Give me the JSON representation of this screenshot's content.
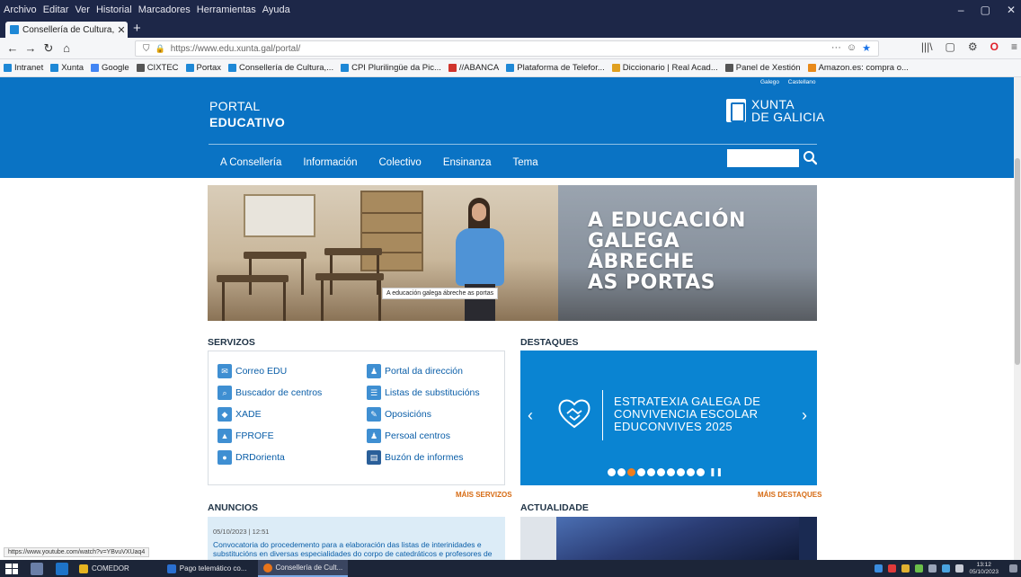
{
  "browser": {
    "menu": [
      "Archivo",
      "Editar",
      "Ver",
      "Historial",
      "Marcadores",
      "Herramientas",
      "Ayuda"
    ],
    "window_controls": [
      "–",
      "▢",
      "✕"
    ],
    "tab_title": "Consellería de Cultura, Educac...",
    "tab_close": "✕",
    "new_tab": "+",
    "nav": {
      "back": "←",
      "forward": "→",
      "reload": "↻",
      "home": "⌂"
    },
    "url": "https://www.edu.xunta.gal/portal/",
    "url_actions": [
      "···",
      "☺",
      "★"
    ],
    "tools": [
      "|||\\",
      "▢",
      "⚙",
      "O",
      "≡"
    ],
    "bookmarks": [
      {
        "label": "Intranet",
        "color": "#1e88d6"
      },
      {
        "label": "Xunta",
        "color": "#1e88d6"
      },
      {
        "label": "Google",
        "color": "#4285f4"
      },
      {
        "label": "CIXTEC",
        "color": "#555555"
      },
      {
        "label": "Portax",
        "color": "#1e88d6"
      },
      {
        "label": "Consellería de Cultura,...",
        "color": "#1e88d6"
      },
      {
        "label": "CPI Plurilingüe da Pic...",
        "color": "#1e88d6"
      },
      {
        "label": "//ABANCA",
        "color": "#d0342c"
      },
      {
        "label": "Plataforma de Telefor...",
        "color": "#1e88d6"
      },
      {
        "label": "Diccionario | Real Acad...",
        "color": "#e0a020"
      },
      {
        "label": "Panel de Xestión",
        "color": "#555555"
      },
      {
        "label": "Amazon.es: compra o...",
        "color": "#e88a1a"
      }
    ]
  },
  "header": {
    "lang": [
      "Galego",
      "Castellano"
    ],
    "portal_line1": "PORTAL",
    "portal_line2": "EDUCATIVO",
    "xunta_line1": "XUNTA",
    "xunta_line2": "DE GALICIA",
    "nav": [
      "A Consellería",
      "Información",
      "Colectivo",
      "Ensinanza",
      "Tema"
    ],
    "search_placeholder": ""
  },
  "hero": {
    "title_lines": [
      "A EDUCACIÓN",
      "GALEGA",
      "ÁBRECHE",
      "AS PORTAS"
    ],
    "caption": "A educación galega ábreche as portas"
  },
  "servizos": {
    "title": "SERVIZOS",
    "left": [
      "Correo EDU",
      "Buscador de centros",
      "XADE",
      "FPROFE",
      "DRDorienta"
    ],
    "right": [
      "Portal da dirección",
      "Listas de substitucións",
      "Oposicións",
      "Persoal centros",
      "Buzón de informes"
    ],
    "more": "MÁIS SERVIZOS"
  },
  "destaques": {
    "title": "DESTAQUES",
    "line1": "ESTRATEXIA GALEGA DE",
    "line2": "CONVIVENCIA ESCOLAR",
    "line3": "EDUCONVIVES 2025",
    "prev": "‹",
    "next": "›",
    "dots_count": 10,
    "active_dot": 3,
    "pause": "❚❚",
    "more": "MÁIS DESTAQUES"
  },
  "anuncios": {
    "title": "ANUNCIOS",
    "date": "05/10/2023 | 12:51",
    "text": "Convocatoria do procedemento para a elaboración das listas de interinidades e substitucións en diversas especialidades do corpo de catedráticos e profesores de"
  },
  "actualidade": {
    "title": "ACTUALIDADE"
  },
  "status_url": "https://www.youtube.com/watch?v=YBvuVXUaq4",
  "taskbar": {
    "items": [
      "COMEDOR",
      "Pago telemático co...",
      "Consellería de Cult..."
    ],
    "time": "13:12",
    "date": "05/10/2023"
  }
}
